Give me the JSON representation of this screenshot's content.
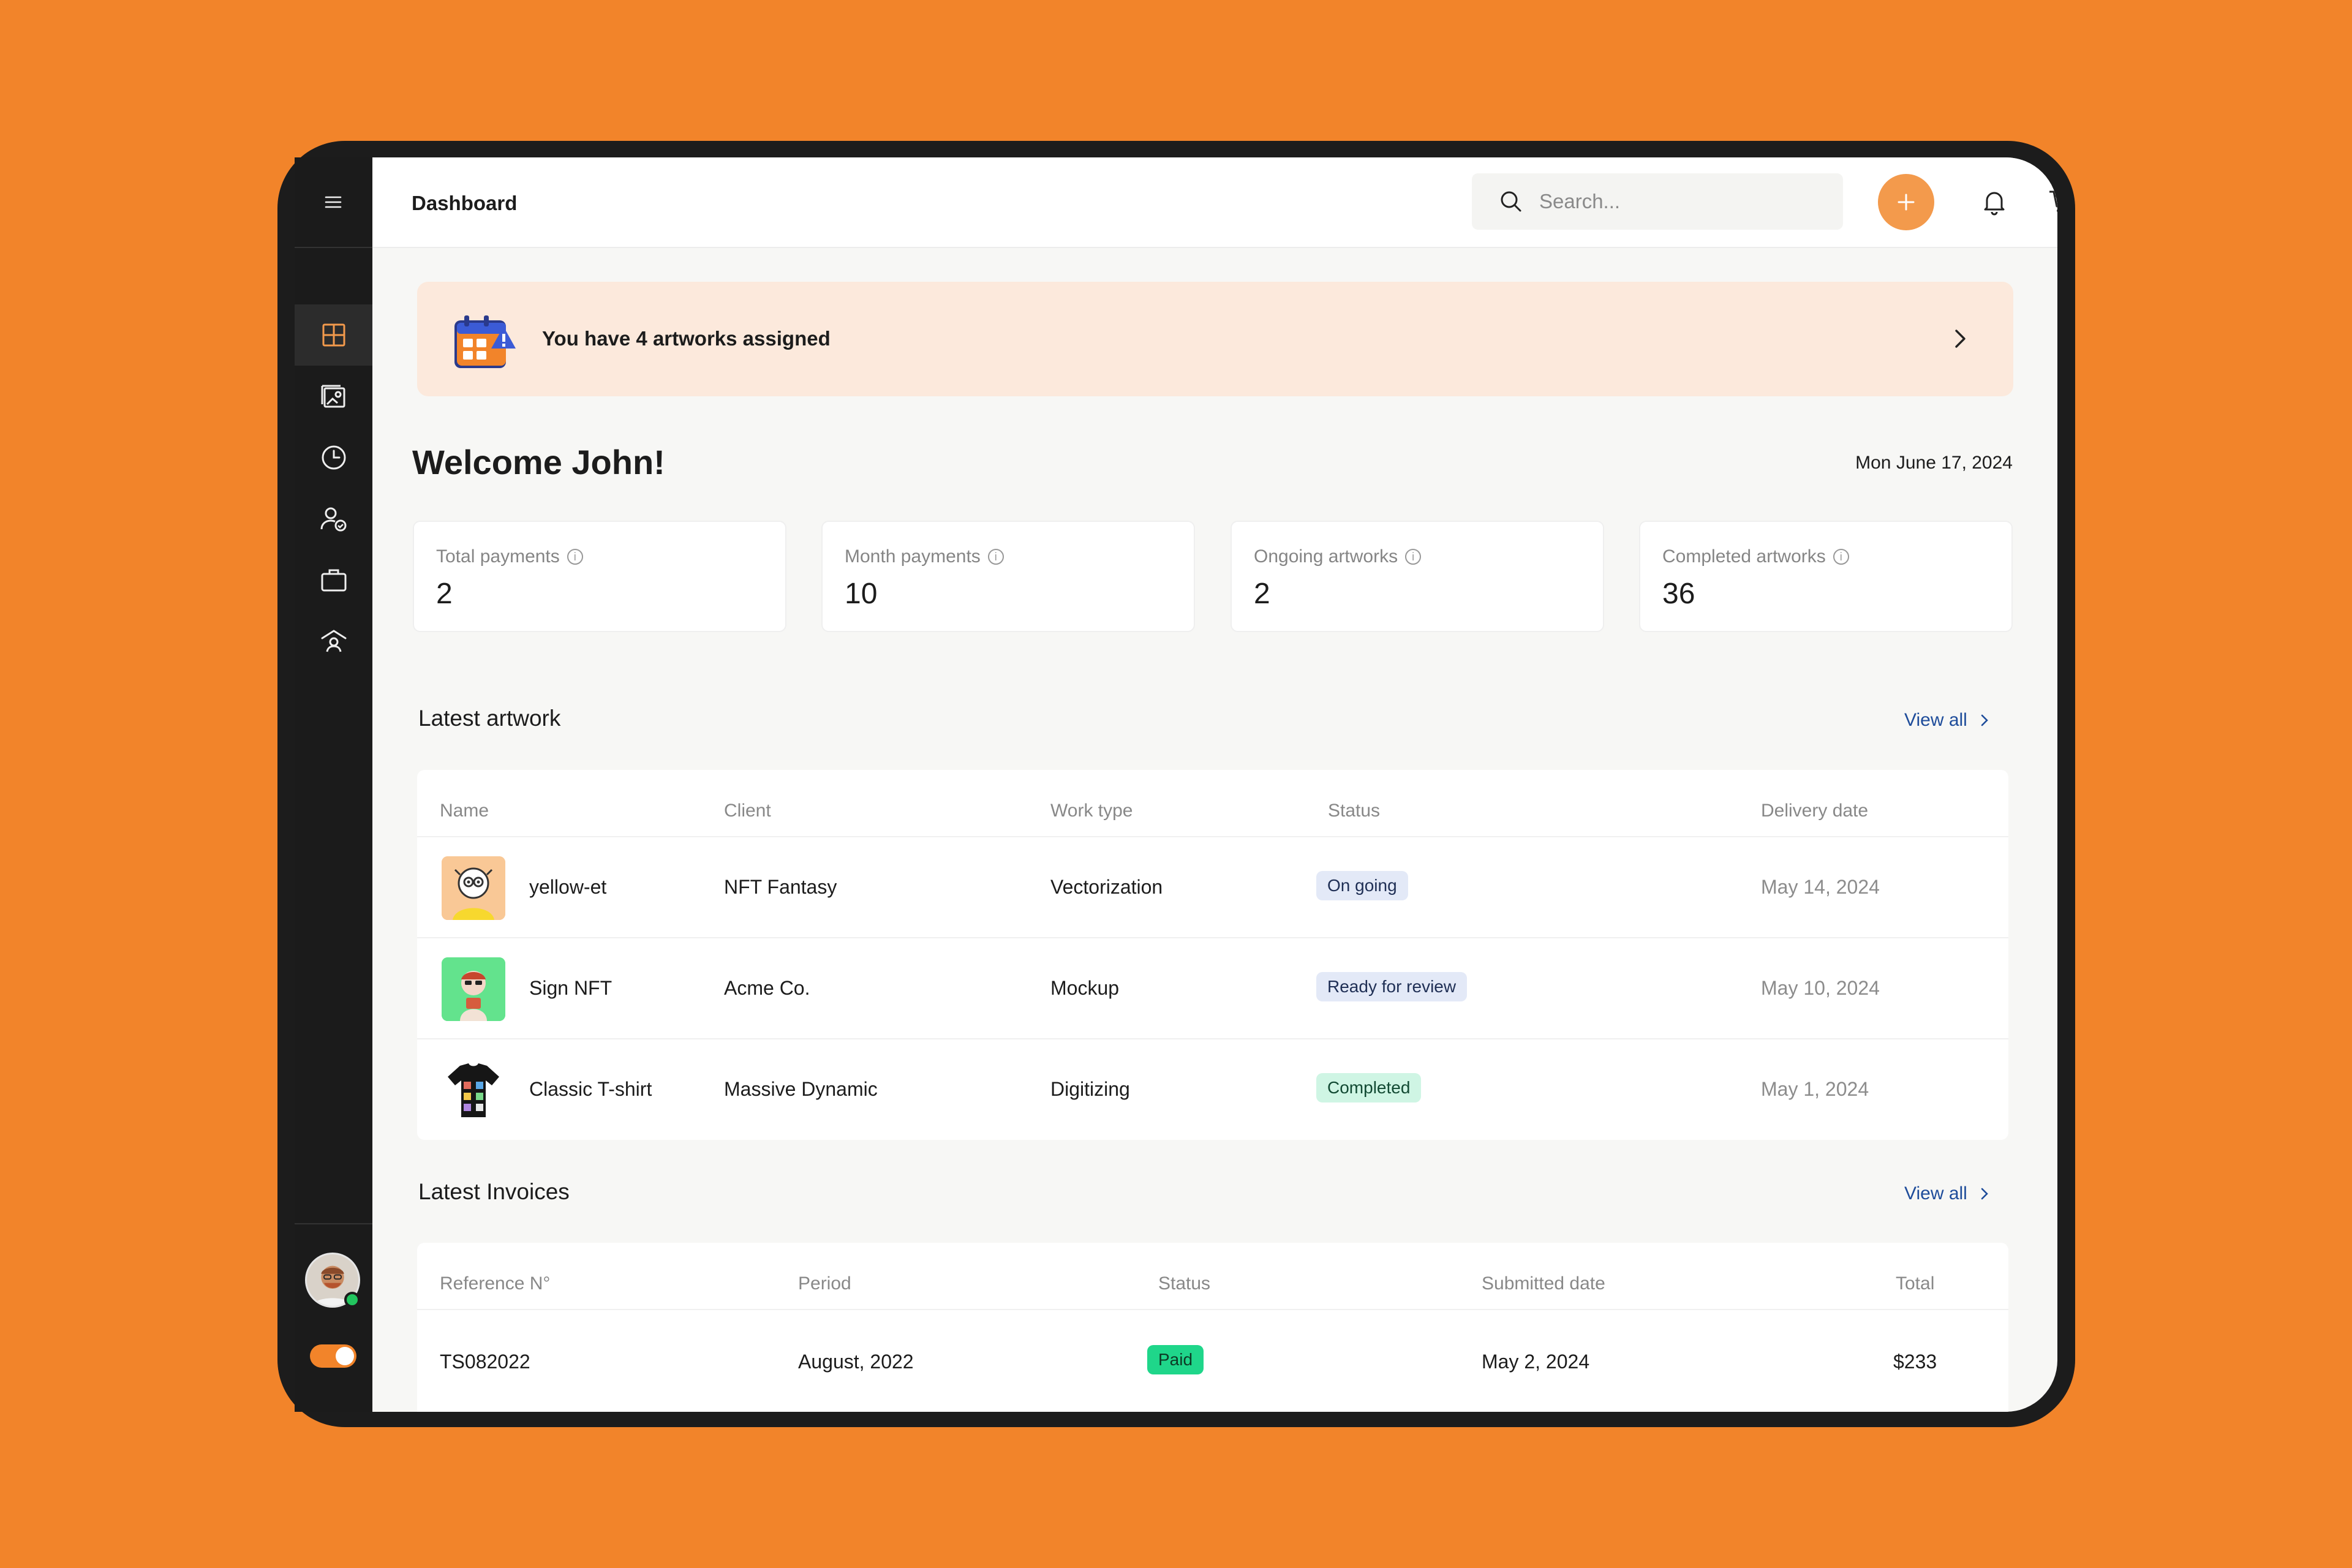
{
  "header": {
    "title": "Dashboard",
    "search_placeholder": "Search..."
  },
  "sidebar": {
    "items": [
      "dashboard-icon",
      "gallery-icon",
      "clock-icon",
      "user-check-icon",
      "briefcase-icon",
      "user-shield-icon"
    ],
    "active_index": 0
  },
  "banner": {
    "text": "You have 4 artworks assigned"
  },
  "welcome": {
    "greeting": "Welcome John!",
    "date": "Mon June 17, 2024"
  },
  "stats": [
    {
      "label": "Total payments",
      "value": "2"
    },
    {
      "label": "Month payments",
      "value": "10"
    },
    {
      "label": "Ongoing artworks",
      "value": "2"
    },
    {
      "label": "Completed artworks",
      "value": "36"
    }
  ],
  "artwork": {
    "title": "Latest artwork",
    "view_all": "View all",
    "columns": [
      "Name",
      "Client",
      "Work type",
      "Status",
      "Delivery date"
    ],
    "rows": [
      {
        "name": "yellow-et",
        "client": "NFT Fantasy",
        "work_type": "Vectorization",
        "status": "On going",
        "date": "May 14, 2024"
      },
      {
        "name": "Sign NFT",
        "client": "Acme Co.",
        "work_type": "Mockup",
        "status": "Ready for review",
        "date": "May 10, 2024"
      },
      {
        "name": "Classic T-shirt",
        "client": "Massive Dynamic",
        "work_type": "Digitizing",
        "status": "Completed",
        "date": "May 1, 2024"
      }
    ]
  },
  "invoices": {
    "title": "Latest Invoices",
    "view_all": "View all",
    "columns": [
      "Reference N°",
      "Period",
      "Status",
      "Submitted date",
      "Total"
    ],
    "rows": [
      {
        "ref": "TS082022",
        "period": "August, 2022",
        "status": "Paid",
        "date": "May 2, 2024",
        "total": "$233"
      }
    ]
  },
  "colors": {
    "brand": "#F2842A",
    "badge_ongoing": "#E3E9F7",
    "badge_review": "#E3E9F7",
    "badge_completed": "#CFF5E4",
    "badge_paid": "#1FD68A"
  }
}
